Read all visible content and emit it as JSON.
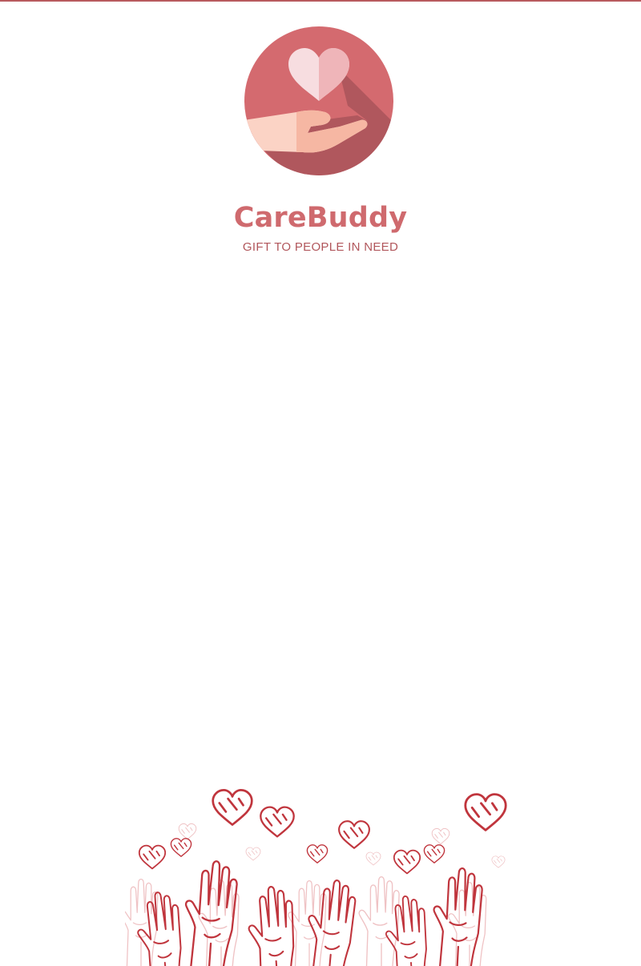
{
  "app": {
    "name": "CareBuddy",
    "tagline": "GIFT TO PEOPLE IN NEED"
  },
  "logo": {
    "icon": "heart-in-hand-icon",
    "circle_color": "#d46a6f",
    "shadow_color": "#a9545a",
    "heart_color": "#f7dde0",
    "heart_shade_color": "#efb5b9",
    "hand_color": "#fbd3c5",
    "hand_shade_color": "#f6b7a3"
  },
  "illustration": {
    "icon": "raised-hands-with-hearts-icon",
    "line_color": "#c0353d",
    "faint_line_color": "#efc2c4"
  },
  "colors": {
    "title": "#cf6a6e",
    "tagline": "#b1565b",
    "background": "#ffffff"
  }
}
